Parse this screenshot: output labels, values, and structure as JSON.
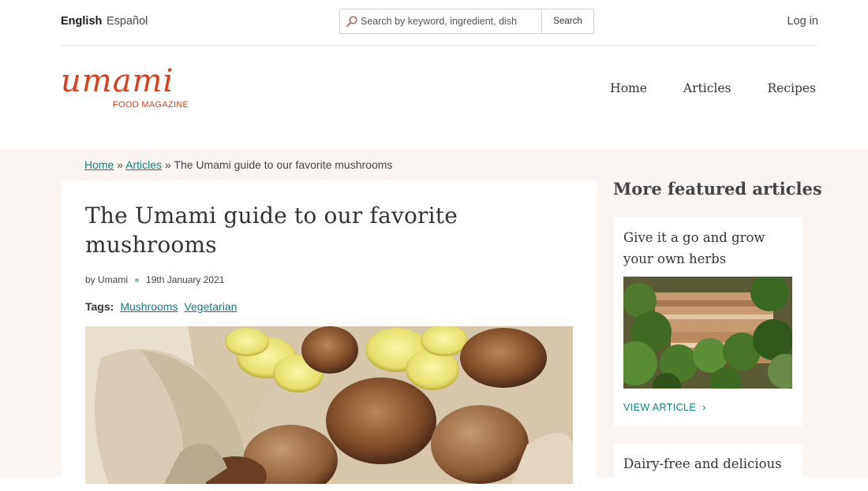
{
  "languages": {
    "active": "English",
    "alternate": "Español"
  },
  "search": {
    "placeholder": "Search by keyword, ingredient, dish",
    "button": "Search",
    "icon": "search-icon"
  },
  "account": {
    "login": "Log in"
  },
  "brand": {
    "wordmark": "umami",
    "tagline": "FOOD MAGAZINE",
    "color": "#d9401e"
  },
  "nav": {
    "items": [
      {
        "label": "Home"
      },
      {
        "label": "Articles"
      },
      {
        "label": "Recipes"
      }
    ]
  },
  "breadcrumb": {
    "home": "Home",
    "articles": "Articles",
    "current": "The Umami guide to our favorite mushrooms",
    "separator": "»"
  },
  "article": {
    "title": "The Umami guide to our favorite mushrooms",
    "author": "by Umami",
    "date": "19th January 2021",
    "tags_label": "Tags:",
    "tags": [
      "Mushrooms",
      "Vegetarian"
    ],
    "hero_image": "mushrooms-photo"
  },
  "sidebar": {
    "heading": "More featured articles",
    "cards": [
      {
        "title": "Give it a go and grow your own herbs",
        "image": "herbs-photo",
        "link": "VIEW ARTICLE"
      },
      {
        "title": "Dairy-free and delicious"
      }
    ]
  },
  "colors": {
    "link": "#0f7d78",
    "background": "#faf5f1",
    "accent": "#d9401e"
  }
}
